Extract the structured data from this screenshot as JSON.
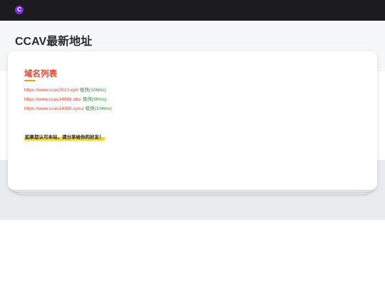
{
  "app": {
    "logo_letter": "C"
  },
  "header": {
    "title": "CCAV最新地址"
  },
  "card": {
    "title": "域名列表",
    "domains": [
      {
        "url": "https://www.ccav2010.xyz/",
        "speed": "极快(106ms)"
      },
      {
        "url": "https://www.ccav14056.sbs/",
        "speed": "极快(90ms)"
      },
      {
        "url": "https://www.ccav14399.cyou/",
        "speed": "极快(104ms)"
      }
    ],
    "share_note": "如果您认可本站，请分享给你的好友！"
  },
  "colors": {
    "topbar": "#1c1c1e",
    "logo": "#7c2fd6",
    "accent_red": "#e0452c",
    "underline_gold": "#e6a118",
    "speed_green": "#2a8a2a",
    "highlight_yellow": "#f5d33b"
  }
}
